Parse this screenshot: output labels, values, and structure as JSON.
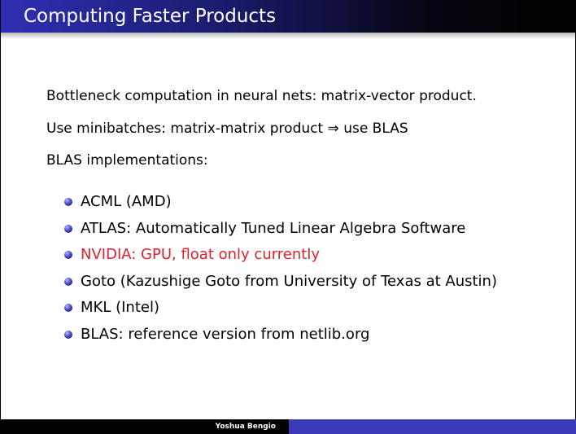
{
  "slide": {
    "title": "Computing Faster Products",
    "paragraphs": [
      "Bottleneck computation in neural nets: matrix-vector product.",
      "Use minibatches: matrix-matrix product ⇒ use BLAS",
      "BLAS implementations:"
    ],
    "bullets": [
      {
        "text": "ACML (AMD)"
      },
      {
        "text": "ATLAS: Automatically Tuned Linear Algebra Software"
      },
      {
        "text": "NVIDIA: GPU, float only currently",
        "color": "#e0202c"
      },
      {
        "text": "Goto (Kazushige Goto from University of Texas at Austin)"
      },
      {
        "text": "MKL (Intel)"
      },
      {
        "text": "BLAS: reference version from netlib.org"
      }
    ],
    "footer": {
      "author": "Yoshua Bengio"
    }
  },
  "colors": {
    "title_bar": "#2f2fb4",
    "footer_right": "#3a3ab8",
    "bullet_ball": "#4a4ac8",
    "highlight": "#e0202c"
  }
}
